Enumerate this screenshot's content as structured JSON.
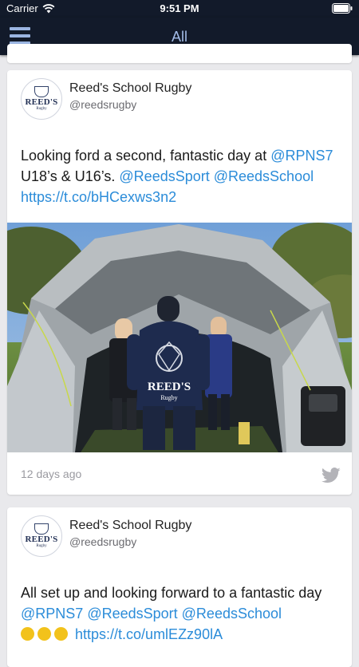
{
  "status_bar": {
    "carrier": "Carrier",
    "time": "9:51 PM"
  },
  "nav": {
    "title": "All"
  },
  "feed": [
    {
      "avatar": {
        "logo_text": "REED'S",
        "logo_sub": "Rugby"
      },
      "author": "Reed's School Rugby",
      "handle": "@reedsrugby",
      "text": {
        "t1": "Looking ford a second, fantastic day at ",
        "m1": "@RPNS7",
        "t2": " U18’s & U16’s. ",
        "m2": "@ReedsSport",
        "t3": " ",
        "m3": "@ReedsSchool",
        "t4": " ",
        "url": "https://t.co/bHCexws3n2"
      },
      "photo_jersey_text": "REED'S",
      "photo_jersey_sub": "Rugby",
      "time_ago": "12 days ago"
    },
    {
      "avatar": {
        "logo_text": "REED'S",
        "logo_sub": "Rugby"
      },
      "author": "Reed's School Rugby",
      "handle": "@reedsrugby",
      "text": {
        "t1": "All set up and looking forward to a fantastic day ",
        "m1": "@RPNS7",
        "t2": " ",
        "m2": "@ReedsSport",
        "t3": " ",
        "m3": "@ReedsSchool",
        "t4": " ",
        "url": "https://t.co/umlEZz90lA"
      }
    }
  ]
}
